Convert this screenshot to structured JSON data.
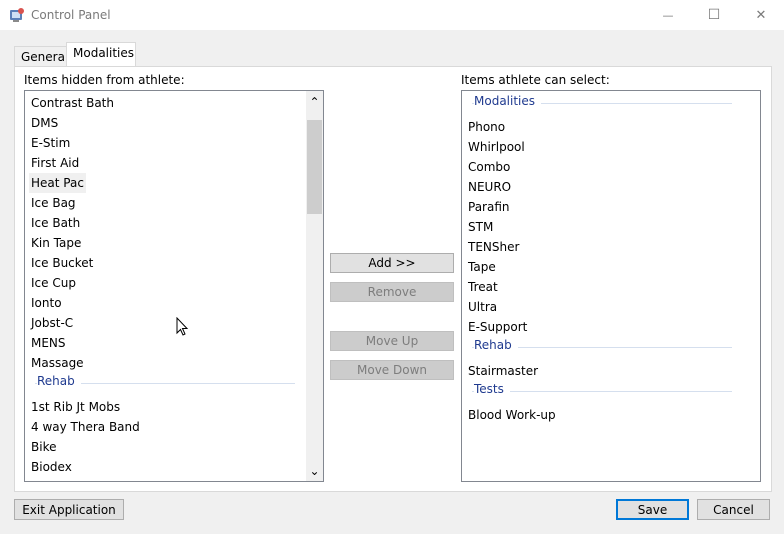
{
  "window": {
    "title": "Control Panel",
    "minimize_glyph": "—",
    "maximize_glyph": "☐",
    "close_glyph": "✕"
  },
  "tabs": [
    {
      "label": "General",
      "selected": false
    },
    {
      "label": "Modalities",
      "selected": true
    }
  ],
  "left_list": {
    "label": "Items hidden from athlete:",
    "items": [
      {
        "text": "Contrast Bath"
      },
      {
        "text": "DMS"
      },
      {
        "text": "E-Stim"
      },
      {
        "text": "First Aid"
      },
      {
        "text": "Heat Pac",
        "selected": true
      },
      {
        "text": "Ice Bag"
      },
      {
        "text": "Ice Bath"
      },
      {
        "text": "Kin Tape"
      },
      {
        "text": "Ice Bucket"
      },
      {
        "text": "Ice Cup"
      },
      {
        "text": "Ionto"
      },
      {
        "text": "Jobst-C"
      },
      {
        "text": "MENS"
      },
      {
        "text": "Massage"
      },
      {
        "group": "Rehab"
      },
      {
        "text": "1st Rib Jt Mobs"
      },
      {
        "text": "4 way Thera Band"
      },
      {
        "text": "Bike"
      },
      {
        "text": "Biodex"
      }
    ],
    "scroll_up_glyph": "⌃",
    "scroll_down_glyph": "⌄"
  },
  "right_list": {
    "label": "Items athlete can select:",
    "items": [
      {
        "group": "Modalities"
      },
      {
        "text": "Phono"
      },
      {
        "text": "Whirlpool"
      },
      {
        "text": "Combo"
      },
      {
        "text": "NEURO"
      },
      {
        "text": "Parafin"
      },
      {
        "text": "STM"
      },
      {
        "text": "TENSher"
      },
      {
        "text": "Tape"
      },
      {
        "text": "Treat"
      },
      {
        "text": "Ultra"
      },
      {
        "text": "E-Support"
      },
      {
        "group": "Rehab"
      },
      {
        "text": "Stairmaster"
      },
      {
        "group": "Tests"
      },
      {
        "text": "Blood Work-up"
      }
    ]
  },
  "actions": {
    "add": "Add >>",
    "remove": "Remove",
    "move_up": "Move Up",
    "move_down": "Move Down"
  },
  "footer": {
    "exit": "Exit Application",
    "save": "Save",
    "cancel": "Cancel"
  },
  "colors": {
    "group_header": "#1f3a8f",
    "default_button_border": "#0078d7"
  }
}
